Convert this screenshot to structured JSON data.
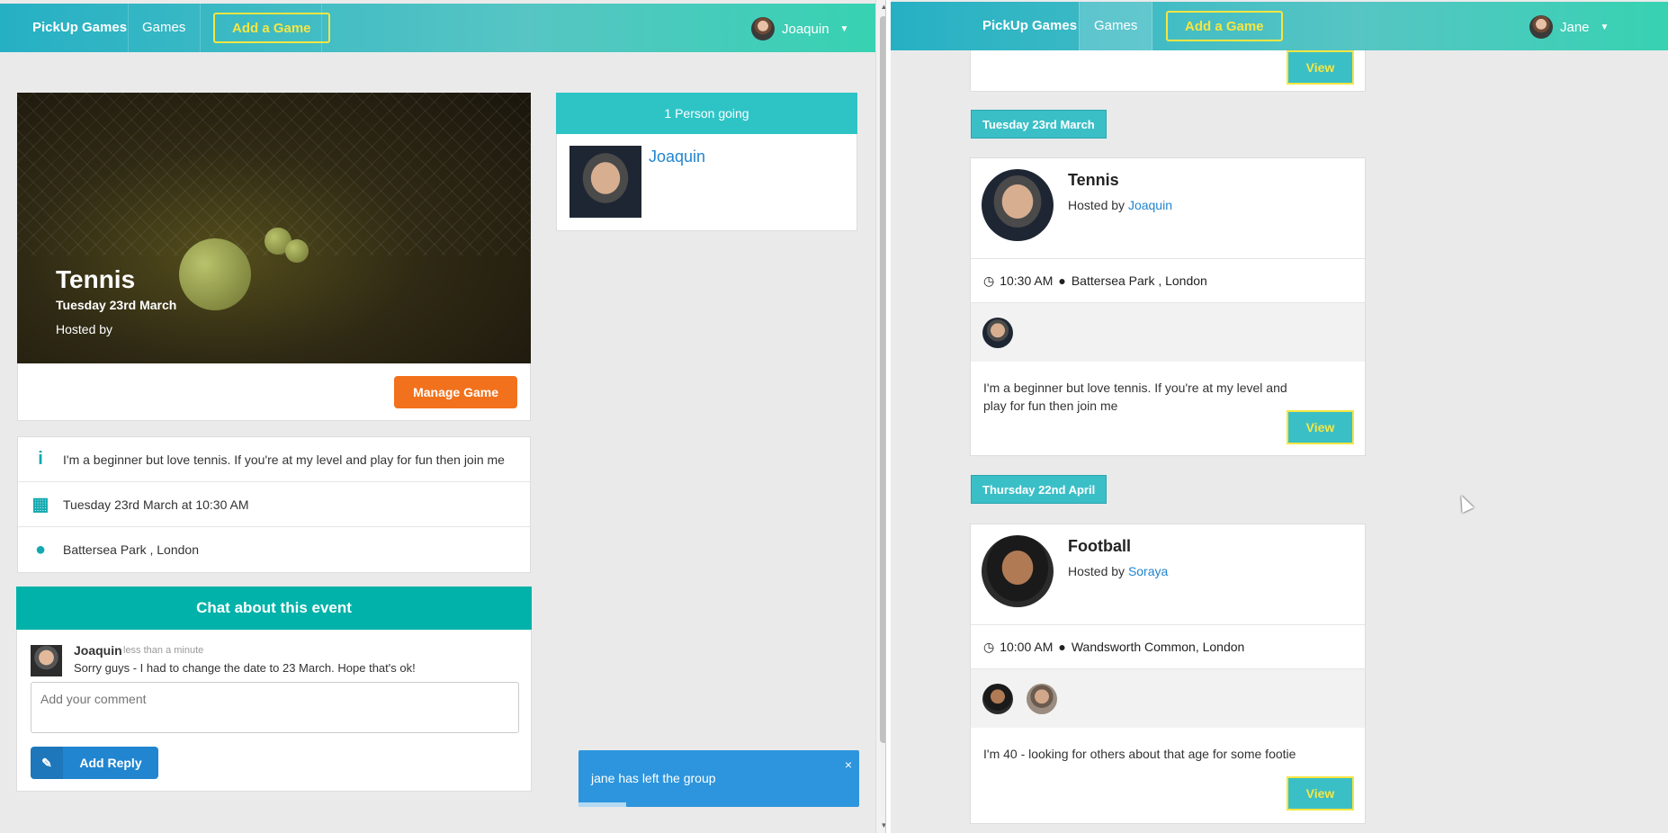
{
  "left": {
    "nav": {
      "brand": "PickUp Games",
      "games": "Games",
      "add": "Add a Game",
      "user": "Joaquin"
    },
    "hero": {
      "title": "Tennis",
      "date": "Tuesday 23rd March",
      "host": "Hosted by"
    },
    "manage_button": "Manage Game",
    "info": {
      "description": "I'm a beginner but love tennis. If you're at my level and play for fun then join me",
      "when": "Tuesday 23rd March at 10:30 AM",
      "where": "Battersea Park , London"
    },
    "going": {
      "header": "1 Person going",
      "attendee": "Joaquin"
    },
    "chat": {
      "header": "Chat about this event",
      "author": "Joaquin",
      "time": "less than a minute",
      "text": "Sorry guys - I had to change the date to 23 March. Hope that's ok!",
      "placeholder": "Add your comment",
      "reply_button": "Add Reply"
    },
    "toast": {
      "message": "jane has left the group",
      "close": "×",
      "progress": 0.17
    }
  },
  "right": {
    "nav": {
      "brand": "PickUp Games",
      "games": "Games",
      "add": "Add a Game",
      "user": "Jane"
    },
    "top_view_button": "View",
    "groups": [
      {
        "date": "Tuesday 23rd March",
        "event": {
          "title": "Tennis",
          "hosted_by": "Hosted by",
          "host": "Joaquin",
          "time": "10:30 AM",
          "venue": "Battersea Park , London",
          "description": "I'm a beginner but love tennis. If you're at my level and play for fun then join me",
          "view": "View"
        }
      },
      {
        "date": "Thursday 22nd April",
        "event": {
          "title": "Football",
          "hosted_by": "Hosted by",
          "host": "Soraya",
          "time": "10:00 AM",
          "venue": "Wandsworth Common, London",
          "description": "I'm 40 - looking for others about that age for some footie",
          "view": "View"
        }
      }
    ]
  },
  "icons": {
    "info": "info-icon",
    "calendar": "calendar-icon",
    "pin": "map-pin-icon",
    "clock": "clock-icon",
    "edit": "edit-icon",
    "caret": "caret-down-icon"
  },
  "colors": {
    "nav_gradient_start": "#26b0c4",
    "nav_gradient_end": "#37d2b2",
    "accent_yellow": "#f5e642",
    "manage_orange": "#f2711c",
    "chat_teal": "#00b2a9",
    "reply_blue": "#2185d0",
    "toast_blue": "#2d95dd"
  }
}
